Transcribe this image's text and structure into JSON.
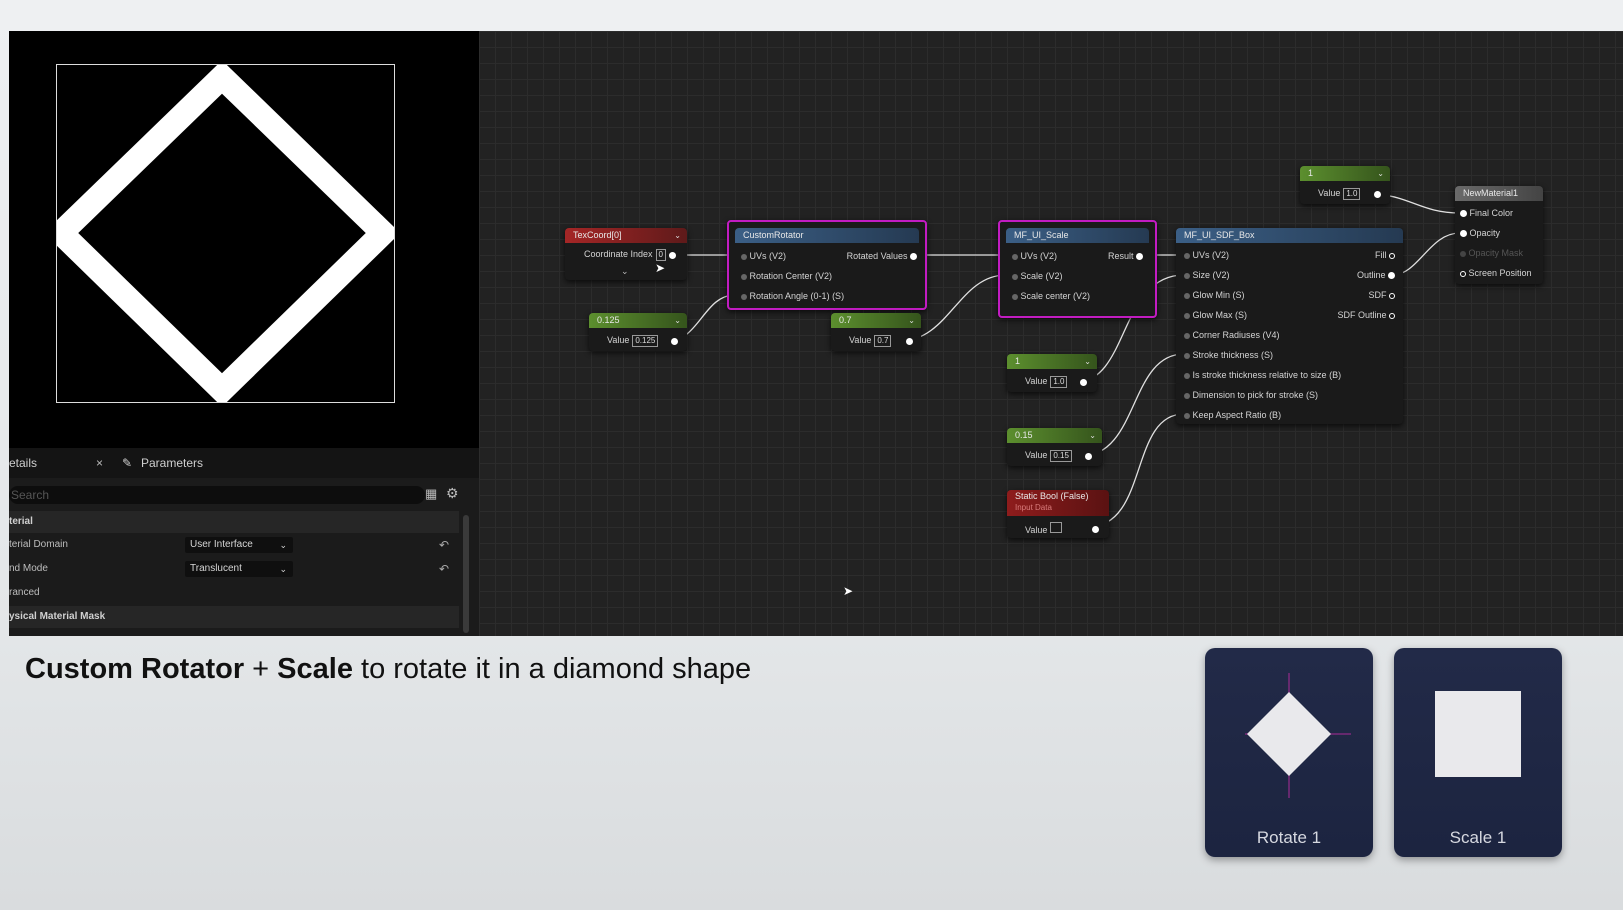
{
  "details": {
    "tab_details": "etails",
    "tab_close": "×",
    "tab_parameters": "Parameters",
    "search_placeholder": "Search",
    "rows": {
      "material": "terial",
      "domain_label": "terial Domain",
      "domain_value": "User Interface",
      "blend_label": "nd Mode",
      "blend_value": "Translucent",
      "advanced": "ranced",
      "phys_mask": "ysical Material Mask"
    }
  },
  "graph": {
    "texcoord": {
      "title": "TexCoord[0]",
      "coord_label": "Coordinate Index",
      "coord_value": "0"
    },
    "const_0125": {
      "title": "0.125",
      "value_label": "Value",
      "value": "0.125"
    },
    "custom_rotator": {
      "title": "CustomRotator",
      "in_uvs": "UVs (V2)",
      "in_center": "Rotation Center (V2)",
      "in_angle": "Rotation Angle (0-1) (S)",
      "out": "Rotated Values"
    },
    "const_07": {
      "title": "0.7",
      "value_label": "Value",
      "value": "0.7"
    },
    "mf_scale": {
      "title": "MF_UI_Scale",
      "in_uvs": "UVs (V2)",
      "in_scale": "Scale (V2)",
      "in_center": "Scale center (V2)",
      "out": "Result"
    },
    "const_1a": {
      "title": "1",
      "value_label": "Value",
      "value": "1.0"
    },
    "const_015": {
      "title": "0.15",
      "value_label": "Value",
      "value": "0.15"
    },
    "static_bool": {
      "title": "Static Bool (False)",
      "subtitle": "Input Data",
      "value_label": "Value"
    },
    "sdf_box": {
      "title": "MF_UI_SDF_Box",
      "inputs": [
        "UVs (V2)",
        "Size (V2)",
        "Glow Min (S)",
        "Glow Max (S)",
        "Corner Radiuses (V4)",
        "Stroke thickness (S)",
        "Is stroke thickness relative to size (B)",
        "Dimension to pick for stroke (S)",
        "Keep Aspect Ratio (B)"
      ],
      "outputs": [
        "Fill",
        "Outline",
        "SDF",
        "SDF Outline"
      ]
    },
    "const_1b": {
      "title": "1",
      "value_label": "Value",
      "value": "1.0"
    },
    "material": {
      "title": "NewMaterial1",
      "pins": [
        "Final Color",
        "Opacity",
        "Opacity Mask",
        "Screen Position"
      ]
    }
  },
  "caption": {
    "bold1": "Custom Rotator",
    "plus": " + ",
    "bold2": "Scale",
    "rest": " to rotate it in a diamond shape"
  },
  "cards": {
    "rotate_label": "Rotate 1",
    "scale_label": "Scale 1"
  },
  "colors": {
    "selection": "#c21cc2",
    "card_bg": "#222a48"
  }
}
